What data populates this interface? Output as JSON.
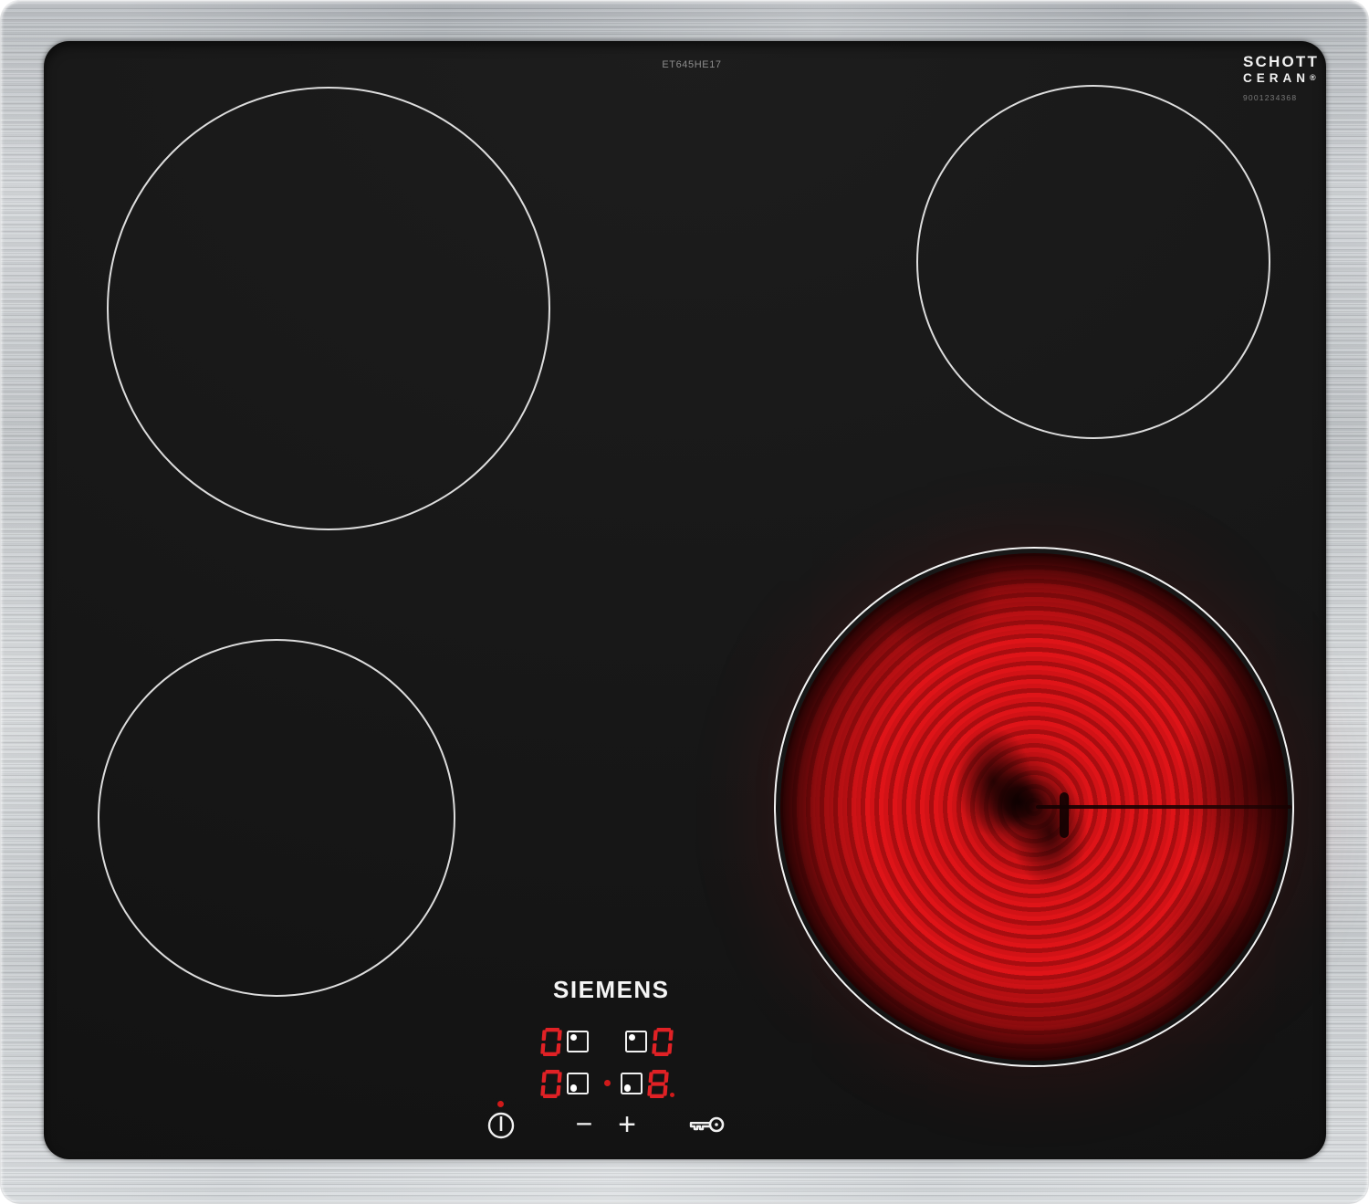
{
  "labels": {
    "model": "ET645HE17",
    "manufacturer": "SIEMENS",
    "glass_brand_line1": "SCHOTT",
    "glass_brand_line2": "CERAN",
    "glass_brand_reg": "®",
    "serial": "9001234368"
  },
  "colors": {
    "display_red": "#e02125",
    "indicator_red": "#cf1a1a",
    "glass_black": "#171717",
    "burner_outline": "#efefef",
    "steel_gray": "#c3c8cc",
    "element_glow": "#df1418"
  },
  "burners": [
    {
      "zone": "rear-left",
      "state": "off"
    },
    {
      "zone": "rear-right",
      "state": "off"
    },
    {
      "zone": "front-left",
      "state": "off"
    },
    {
      "zone": "front-right",
      "state": "on",
      "power_level": "8"
    }
  ],
  "displays": [
    {
      "zone": "rear-left",
      "value": "0",
      "dot": "top-left"
    },
    {
      "zone": "rear-right",
      "value": "0",
      "dot": "top-left"
    },
    {
      "zone": "front-left",
      "value": "0",
      "dot": "bottom-left"
    },
    {
      "zone": "front-right",
      "value": "8",
      "decimal": true,
      "dot": "bottom-left",
      "active_indicator": true
    }
  ],
  "controls": {
    "power_icon": "power-icon",
    "minus_label": "−",
    "plus_label": "+",
    "lock_icon": "key-icon"
  }
}
